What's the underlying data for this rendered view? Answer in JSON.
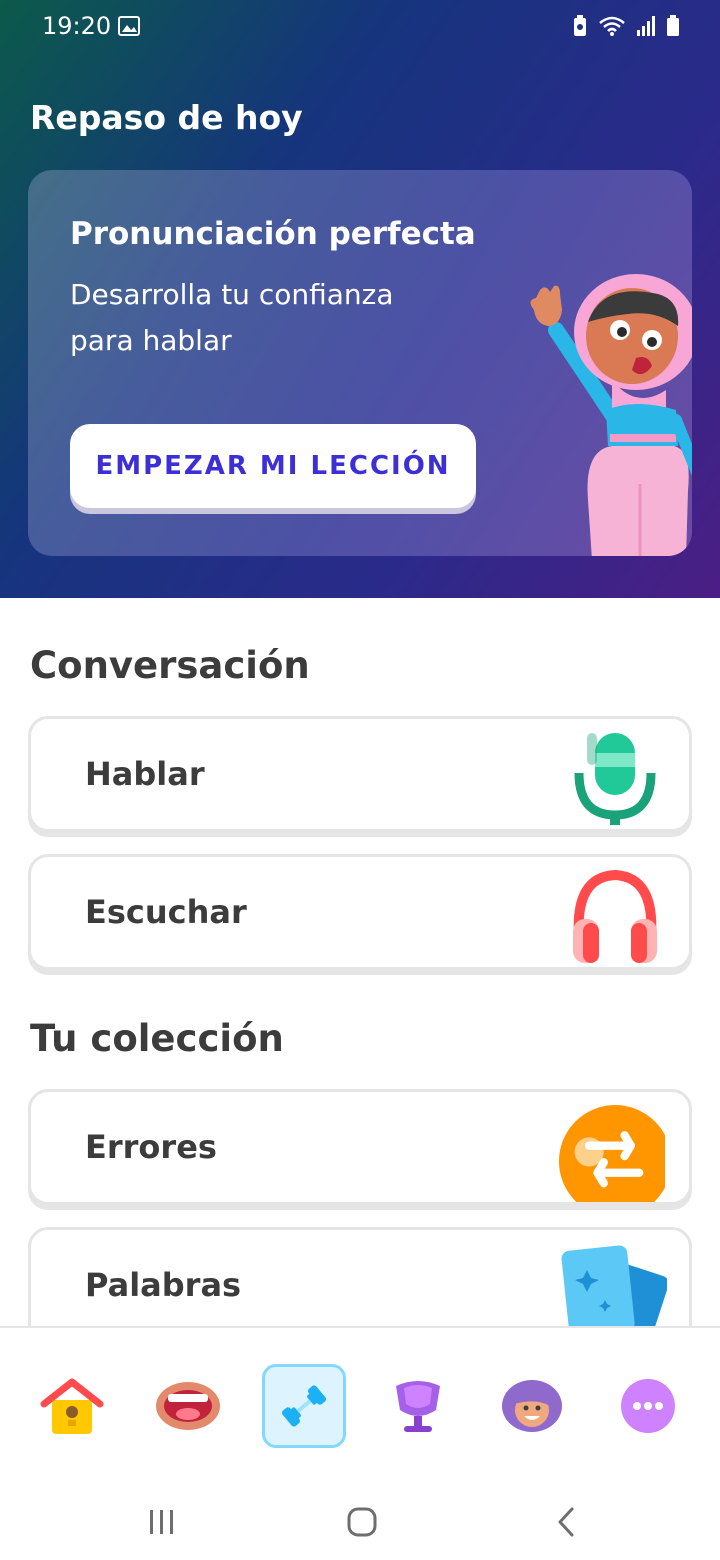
{
  "status": {
    "time": "19:20",
    "image_icon": "image-icon",
    "icons": [
      "battery-saver-icon",
      "wifi-icon",
      "signal-icon",
      "battery-icon"
    ]
  },
  "hero": {
    "title": "Repaso de hoy",
    "card_title": "Pronunciación perfecta",
    "card_subtitle": "Desarrolla tu confianza para hablar",
    "button_label": "EMPEZAR MI LECCIÓN"
  },
  "conversation": {
    "title": "Conversación",
    "items": [
      {
        "label": "Hablar",
        "icon": "microphone-icon"
      },
      {
        "label": "Escuchar",
        "icon": "headphones-icon"
      }
    ]
  },
  "collection": {
    "title": "Tu colección",
    "items": [
      {
        "label": "Errores",
        "icon": "refresh-icon"
      },
      {
        "label": "Palabras",
        "icon": "flashcards-icon"
      }
    ]
  },
  "bottom_nav": [
    "home-icon",
    "speaking-icon",
    "practice-icon",
    "league-icon",
    "profile-icon",
    "more-icon"
  ],
  "colors": {
    "accent": "#3c2fd6",
    "text": "#3c3c3c",
    "border": "#e5e5e5"
  }
}
